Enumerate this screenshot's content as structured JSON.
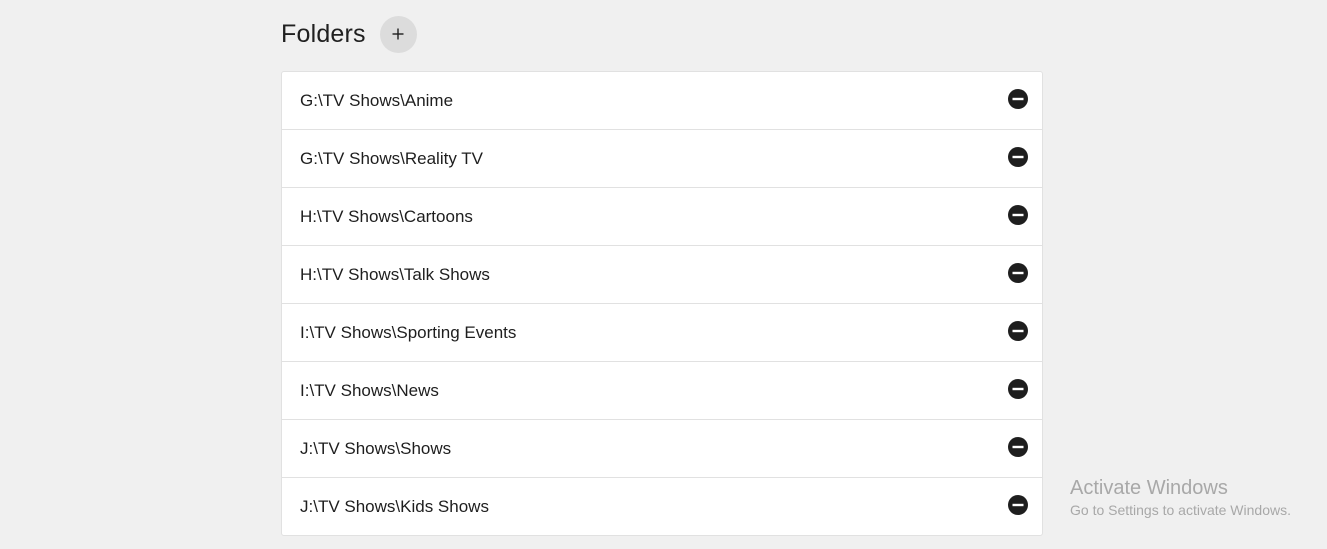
{
  "header": {
    "title": "Folders",
    "add_button_icon": "plus-icon"
  },
  "folders": [
    {
      "path": "G:\\TV Shows\\Anime",
      "remove_icon": "minus-circle-icon"
    },
    {
      "path": "G:\\TV Shows\\Reality TV",
      "remove_icon": "minus-circle-icon"
    },
    {
      "path": "H:\\TV Shows\\Cartoons",
      "remove_icon": "minus-circle-icon"
    },
    {
      "path": "H:\\TV Shows\\Talk Shows",
      "remove_icon": "minus-circle-icon"
    },
    {
      "path": "I:\\TV Shows\\Sporting Events",
      "remove_icon": "minus-circle-icon"
    },
    {
      "path": "I:\\TV Shows\\News",
      "remove_icon": "minus-circle-icon"
    },
    {
      "path": "J:\\TV Shows\\Shows",
      "remove_icon": "minus-circle-icon"
    },
    {
      "path": "J:\\TV Shows\\Kids Shows",
      "remove_icon": "minus-circle-icon"
    }
  ],
  "watermark": {
    "title": "Activate Windows",
    "subtitle": "Go to Settings to activate Windows."
  },
  "colors": {
    "background": "#f0f0f0",
    "list_background": "#ffffff",
    "border": "#e1e1e1",
    "icon": "#1e1e1e",
    "add_button_bg": "#dcdcdc"
  }
}
